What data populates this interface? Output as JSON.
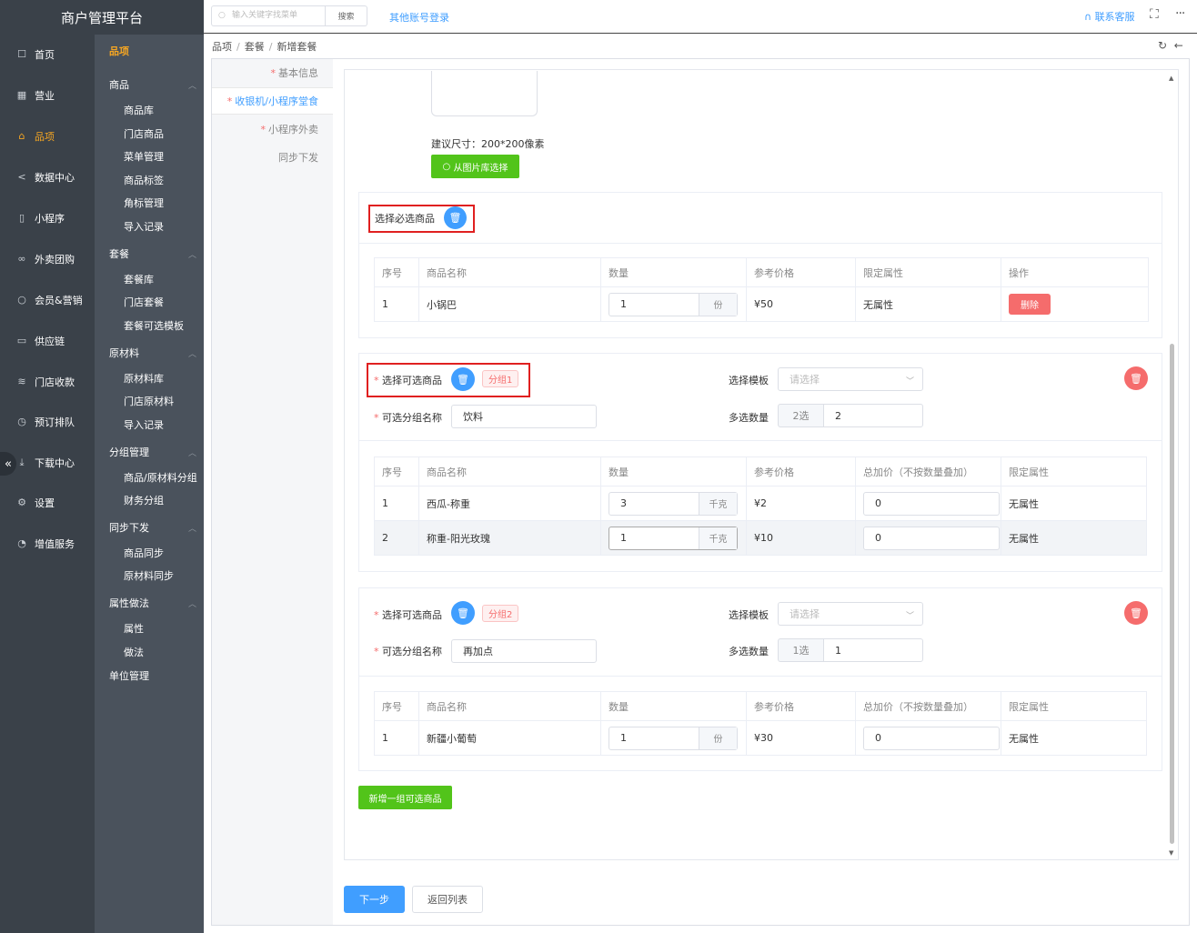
{
  "app": {
    "title": "商户管理平台"
  },
  "topbar": {
    "search_placeholder": "输入关键字找菜单",
    "search_button": "搜索",
    "other_login": "其他账号登录",
    "contact": "联系客服"
  },
  "sidebar": {
    "items": [
      {
        "label": "首页",
        "icon": "home-icon"
      },
      {
        "label": "营业",
        "icon": "calendar-icon"
      },
      {
        "label": "品项",
        "icon": "bag-icon",
        "active": true
      },
      {
        "label": "数据中心",
        "icon": "share-icon"
      },
      {
        "label": "小程序",
        "icon": "mobile-icon"
      },
      {
        "label": "外卖团购",
        "icon": "bike-icon"
      },
      {
        "label": "会员&营销",
        "icon": "user-icon"
      },
      {
        "label": "供应链",
        "icon": "truck-icon"
      },
      {
        "label": "门店收款",
        "icon": "coins-icon"
      },
      {
        "label": "预订排队",
        "icon": "clock-icon"
      },
      {
        "label": "下载中心",
        "icon": "download-icon"
      },
      {
        "label": "设置",
        "icon": "gear-icon"
      },
      {
        "label": "增值服务",
        "icon": "alarm-icon"
      }
    ]
  },
  "subnav": {
    "title": "品项",
    "groups": [
      {
        "label": "商品",
        "items": [
          "商品库",
          "门店商品",
          "菜单管理",
          "商品标签",
          "角标管理",
          "导入记录"
        ]
      },
      {
        "label": "套餐",
        "items": [
          "套餐库",
          "门店套餐",
          "套餐可选模板"
        ]
      },
      {
        "label": "原材料",
        "items": [
          "原材料库",
          "门店原材料",
          "导入记录"
        ]
      },
      {
        "label": "分组管理",
        "items": [
          "商品/原材料分组",
          "财务分组"
        ]
      },
      {
        "label": "同步下发",
        "items": [
          "商品同步",
          "原材料同步"
        ]
      },
      {
        "label": "属性做法",
        "items": [
          "属性",
          "做法"
        ]
      },
      {
        "label": "单位管理",
        "items": []
      }
    ]
  },
  "breadcrumb": [
    "品项",
    "套餐",
    "新增套餐"
  ],
  "steps": [
    {
      "label": "基本信息",
      "required": true
    },
    {
      "label": "收银机/小程序堂食",
      "required": true,
      "active": true
    },
    {
      "label": "小程序外卖",
      "required": true
    },
    {
      "label": "同步下发",
      "required": false
    }
  ],
  "image": {
    "hint": "建议尺寸：200*200像素",
    "pick_button": "从图片库选择"
  },
  "required_section": {
    "title": "选择必选商品",
    "columns": [
      "序号",
      "商品名称",
      "数量",
      "参考价格",
      "限定属性",
      "操作"
    ],
    "rows": [
      {
        "no": "1",
        "name": "小锅巴",
        "qty": "1",
        "unit": "份",
        "price": "¥50",
        "attr": "无属性",
        "action": "删除"
      }
    ]
  },
  "optional_groups": [
    {
      "title": "选择可选商品",
      "tag": "分组1",
      "template_label": "选择模板",
      "template_placeholder": "请选择",
      "name_label": "可选分组名称",
      "name_value": "饮料",
      "count_label": "多选数量",
      "count_prefix": "2选",
      "count_value": "2",
      "columns": [
        "序号",
        "商品名称",
        "数量",
        "参考价格",
        "总加价（不按数量叠加）",
        "限定属性"
      ],
      "rows": [
        {
          "no": "1",
          "name": "西瓜-称重",
          "qty": "3",
          "unit": "千克",
          "price": "¥2",
          "extra": "0",
          "attr": "无属性"
        },
        {
          "no": "2",
          "name": "称重-阳光玫瑰",
          "qty": "1",
          "unit": "千克",
          "price": "¥10",
          "extra": "0",
          "attr": "无属性"
        }
      ]
    },
    {
      "title": "选择可选商品",
      "tag": "分组2",
      "template_label": "选择模板",
      "template_placeholder": "请选择",
      "name_label": "可选分组名称",
      "name_value": "再加点",
      "count_label": "多选数量",
      "count_prefix": "1选",
      "count_value": "1",
      "columns": [
        "序号",
        "商品名称",
        "数量",
        "参考价格",
        "总加价（不按数量叠加）",
        "限定属性"
      ],
      "rows": [
        {
          "no": "1",
          "name": "新疆小葡萄",
          "qty": "1",
          "unit": "份",
          "price": "¥30",
          "extra": "0",
          "attr": "无属性"
        }
      ]
    }
  ],
  "add_group_button": "新增一组可选商品",
  "footer": {
    "next": "下一步",
    "back": "返回列表"
  },
  "colors": {
    "primary": "#409eff",
    "success": "#52c41a",
    "danger": "#f56c6c",
    "active_nav": "#f5a623",
    "sidebar": "#3a4149"
  }
}
